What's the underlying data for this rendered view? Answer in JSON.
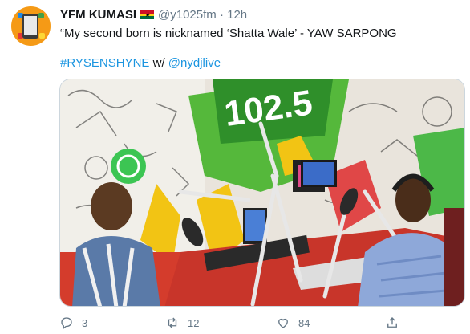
{
  "tweet": {
    "name": "YFM KUMASI",
    "handle": "@y1025fm",
    "separator": "·",
    "time": "12h",
    "text": "“My second born is nicknamed ‘Shatta Wale’ - YAW SARPONG",
    "hashtag": "#RYSENSHYNE",
    "with": " w/ ",
    "mention": "@nydjlive",
    "replies": "3",
    "retweets": "12",
    "likes": "84"
  },
  "icons": {
    "avatar": "yfm-logo",
    "flag": "ghana-flag-icon",
    "reply": "reply-icon",
    "retweet": "retweet-icon",
    "like": "heart-icon",
    "share": "share-icon"
  },
  "colors": {
    "link": "#1b95e0",
    "muted": "#657786",
    "avatar_bg": "#f59a16"
  }
}
